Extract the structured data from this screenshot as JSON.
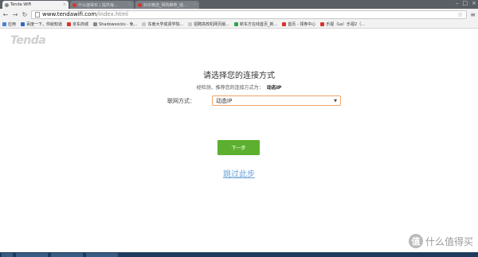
{
  "browser": {
    "tabs": [
      {
        "label": "Tenda WiFi"
      },
      {
        "label": "什么值得买 | 提供海..."
      },
      {
        "label": "好价精选_网购推荐_值..."
      }
    ],
    "url_host": "www.tendawifi.com",
    "url_path": "/index.html",
    "bookmarks": [
      {
        "label": "应用",
        "color": "#4a7fd8"
      },
      {
        "label": "百度一下，你就知道",
        "color": "#2f66c9"
      },
      {
        "label": "京东商城",
        "color": "#d9342b"
      },
      {
        "label": "Shadowsocks - 免...",
        "color": "#888888"
      },
      {
        "label": "东南大学成贤学院...",
        "color": "#c8c8c8"
      },
      {
        "label": "招聘高校机网页版...",
        "color": "#c8c8c8"
      },
      {
        "label": "新东方在线首页_新...",
        "color": "#2fa34e"
      },
      {
        "label": "首页 - 领券中心",
        "color": "#d9342b"
      },
      {
        "label": "乐视（Le）乐视2（...",
        "color": "#d9342b"
      }
    ]
  },
  "page": {
    "logo": "Tenda",
    "title": "请选择您的连接方式",
    "detected_text": "经检测，推荐您的连接方式为：",
    "detected_value": "动态IP",
    "conn_label": "联网方式：",
    "conn_selected": "动态IP",
    "next_label": "下一步",
    "skip_label": "跳过此步"
  },
  "watermark": {
    "badge": "值",
    "text": "什么值得买"
  },
  "colors": {
    "accent_green": "#5db02f",
    "link_blue": "#6aa2d8",
    "select_border": "#f0a46a"
  }
}
